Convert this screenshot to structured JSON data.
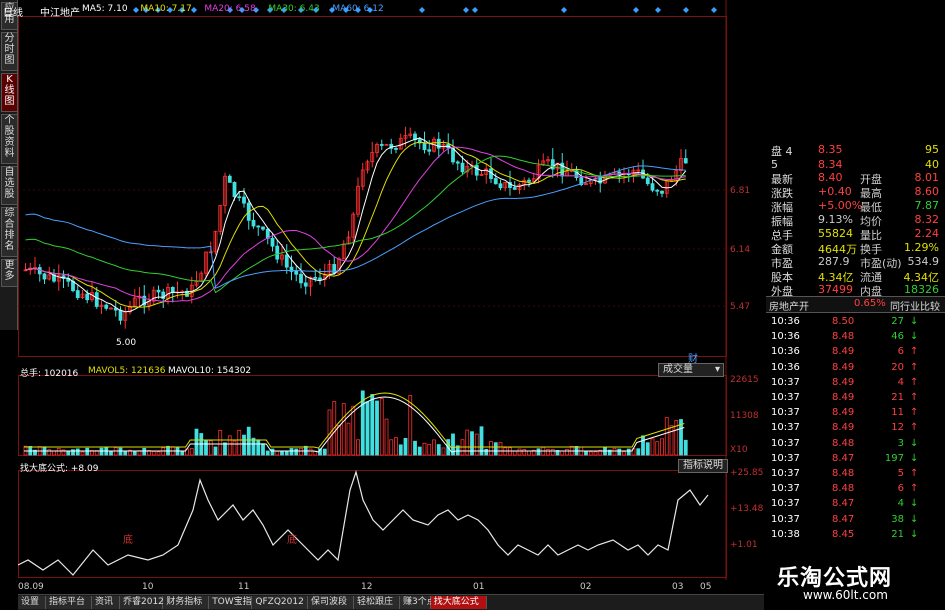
{
  "sidebar": {
    "items": [
      "应用",
      "分时图",
      "K线图",
      "个股资料",
      "自选股",
      "综合排名",
      "更多"
    ]
  },
  "header": {
    "period": "日线",
    "stock_name": "中江地产",
    "ma": [
      {
        "label": "MA5: 7.10",
        "color": "#ffffff"
      },
      {
        "label": "MA10: 7.17",
        "color": "#e0e000"
      },
      {
        "label": "MA20: 6.58",
        "color": "#e040e0"
      },
      {
        "label": "MA30: 6.43",
        "color": "#30d030"
      },
      {
        "label": "MA60: 6.12",
        "color": "#4aa0ff"
      }
    ]
  },
  "price_axis": [
    "6.81",
    "6.14",
    "5.47"
  ],
  "low_marker": "5.00",
  "volume": {
    "label": "总手: 102016",
    "mavol5": "MAVOL5: 121636",
    "mavol10": "MAVOL10: 154302",
    "dropdown": "成交量",
    "axis": [
      "22615",
      "11308",
      "X10"
    ],
    "fin_marker": "财"
  },
  "indicator": {
    "label": "找大底公式: +8.09",
    "button": "指标说明",
    "axis": [
      "+25.85",
      "+13.48",
      "+1.01"
    ],
    "marks": [
      "底",
      "底"
    ]
  },
  "x_axis": [
    "08.09",
    "10",
    "11",
    "12",
    "01",
    "02",
    "03",
    "05"
  ],
  "quote": {
    "rows": [
      {
        "l": "盘",
        "v": "4",
        "p": "8.35",
        "r": "",
        "q": "95",
        "pc": "#ff4040",
        "rc": "#ccc",
        "qc": "#e0e000"
      },
      {
        "l": "",
        "v": "5",
        "p": "8.34",
        "r": "",
        "q": "40",
        "pc": "#ff4040",
        "rc": "#ccc",
        "qc": "#e0e000"
      },
      {
        "l": "最新",
        "v": "",
        "p": "8.40",
        "r": "开盘",
        "q": "8.01",
        "pc": "#ff4040",
        "rc": "#ccc",
        "qc": "#ff4040"
      },
      {
        "l": "涨跌",
        "v": "",
        "p": "+0.40",
        "r": "最高",
        "q": "8.60",
        "pc": "#ff4040",
        "rc": "#ccc",
        "qc": "#ff4040"
      },
      {
        "l": "涨幅",
        "v": "",
        "p": "+5.00%",
        "r": "最低",
        "q": "7.87",
        "pc": "#ff4040",
        "rc": "#ccc",
        "qc": "#30d030"
      },
      {
        "l": "振幅",
        "v": "",
        "p": "9.13%",
        "r": "均价",
        "q": "8.32",
        "pc": "#ccc",
        "rc": "#ccc",
        "qc": "#ff4040"
      },
      {
        "l": "总手",
        "v": "",
        "p": "55824",
        "r": "量比",
        "q": "2.24",
        "pc": "#e0e000",
        "rc": "#ccc",
        "qc": "#ff4040"
      },
      {
        "l": "金额",
        "v": "",
        "p": "4644万",
        "r": "换手",
        "q": "1.29%",
        "pc": "#e0e000",
        "rc": "#ccc",
        "qc": "#e0e000"
      },
      {
        "l": "市盈",
        "v": "",
        "p": "287.9",
        "r": "市盈(动)",
        "q": "534.9",
        "pc": "#ccc",
        "rc": "#ccc",
        "qc": "#ccc"
      },
      {
        "l": "股本",
        "v": "",
        "p": "4.34亿",
        "r": "流通",
        "q": "4.34亿",
        "pc": "#e0e000",
        "rc": "#ccc",
        "qc": "#e0e000"
      },
      {
        "l": "外盘",
        "v": "",
        "p": "37499",
        "r": "内盘",
        "q": "18326",
        "pc": "#ff4040",
        "rc": "#ccc",
        "qc": "#30d030"
      }
    ],
    "sector": {
      "name": "房地产开",
      "change": "0.65%",
      "compare": "同行业比较"
    }
  },
  "ticks": [
    {
      "t": "10:36",
      "p": "8.50",
      "n": "27",
      "d": "down"
    },
    {
      "t": "10:36",
      "p": "8.48",
      "n": "46",
      "d": "down"
    },
    {
      "t": "10:36",
      "p": "8.49",
      "n": "6",
      "d": "up"
    },
    {
      "t": "10:36",
      "p": "8.49",
      "n": "20",
      "d": "up"
    },
    {
      "t": "10:37",
      "p": "8.49",
      "n": "4",
      "d": "up"
    },
    {
      "t": "10:37",
      "p": "8.49",
      "n": "21",
      "d": "up"
    },
    {
      "t": "10:37",
      "p": "8.49",
      "n": "11",
      "d": "up"
    },
    {
      "t": "10:37",
      "p": "8.49",
      "n": "12",
      "d": "up"
    },
    {
      "t": "10:37",
      "p": "8.48",
      "n": "3",
      "d": "down"
    },
    {
      "t": "10:37",
      "p": "8.47",
      "n": "197",
      "d": "down"
    },
    {
      "t": "10:37",
      "p": "8.48",
      "n": "5",
      "d": "up"
    },
    {
      "t": "10:37",
      "p": "8.48",
      "n": "6",
      "d": "up"
    },
    {
      "t": "10:37",
      "p": "8.47",
      "n": "4",
      "d": "down"
    },
    {
      "t": "10:37",
      "p": "8.47",
      "n": "38",
      "d": "down"
    },
    {
      "t": "10:38",
      "p": "8.45",
      "n": "21",
      "d": "down"
    }
  ],
  "tabs": [
    "设置",
    "指标平台",
    "资讯",
    "乔睿2012",
    "财务指标",
    "TOW宝指线",
    "QFZQ2012",
    "保司波段",
    "轻松跟庄",
    "赚3个点",
    "找大底公式"
  ],
  "active_tab": "找大底公式",
  "watermark": {
    "title": "乐淘公式网",
    "url": "www.60lt.com"
  }
}
